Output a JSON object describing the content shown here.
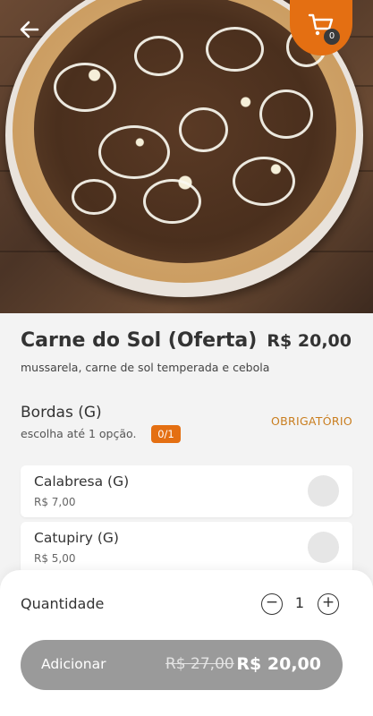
{
  "header": {
    "back_icon": "arrow-left-icon",
    "cart_icon": "shopping-cart-icon",
    "cart_count": "0",
    "accent_color": "#e46f12"
  },
  "product": {
    "name": "Carne do Sol (Oferta)",
    "price": "R$ 20,00",
    "description": "mussarela, carne de sol temperada e cebola"
  },
  "option_group": {
    "title": "Bordas (G)",
    "subtitle": "escolha até 1 opção.",
    "count": "0/1",
    "required_label": "OBRIGATÓRIO",
    "options": [
      {
        "name": "Calabresa (G)",
        "price": "R$ 7,00"
      },
      {
        "name": "Catupiry (G)",
        "price": "R$ 5,00"
      }
    ]
  },
  "quantity": {
    "label": "Quantidade",
    "value": "1",
    "minus_icon": "minus-circle-icon",
    "plus_icon": "plus-circle-icon"
  },
  "add_button": {
    "label": "Adicionar",
    "old_price": "R$ 27,00",
    "price": "R$ 20,00"
  }
}
